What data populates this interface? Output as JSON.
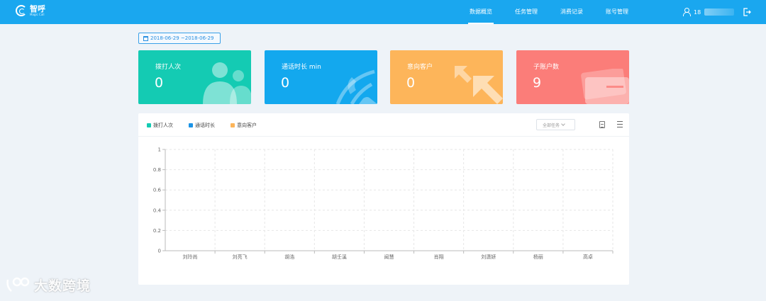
{
  "header": {
    "app_name": "智呼",
    "app_subtitle": "Magic Call",
    "nav": [
      {
        "label": "数据概览",
        "active": true
      },
      {
        "label": "任务管理",
        "active": false
      },
      {
        "label": "消费记录",
        "active": false
      },
      {
        "label": "账号管理",
        "active": false
      }
    ],
    "user_prefix": "18",
    "icons": {
      "user": "user-icon",
      "logout": "logout-icon"
    }
  },
  "date_range": "2018-06-29 ~2018-06-29",
  "stats": [
    {
      "label": "拨打人次",
      "value": "0",
      "color": "#14cbb3",
      "icon": "users-icon"
    },
    {
      "label": "通话时长 min",
      "value": "0",
      "color": "#13a8ee",
      "icon": "phone-icon"
    },
    {
      "label": "意向客户",
      "value": "0",
      "color": "#fdb55a",
      "icon": "arrow-icon"
    },
    {
      "label": "子账户数",
      "value": "9",
      "color": "#fb7d79",
      "icon": "card-icon"
    }
  ],
  "chart_panel": {
    "legend": [
      {
        "label": "拨打人次",
        "color": "#14cbb3"
      },
      {
        "label": "通话时长",
        "color": "#1c94e6"
      },
      {
        "label": "意向客户",
        "color": "#fdb55a"
      }
    ],
    "task_filter": "全部任务"
  },
  "chart_data": {
    "type": "bar",
    "categories": [
      "刘玲尚",
      "刘亮飞",
      "胡浩",
      "胡壬溪",
      "闻慧",
      "肖翔",
      "刘潇妍",
      "杨丽",
      "高卓"
    ],
    "series": [
      {
        "name": "拨打人次",
        "values": [
          0,
          0,
          0,
          0,
          0,
          0,
          0,
          0,
          0
        ]
      },
      {
        "name": "通话时长",
        "values": [
          0,
          0,
          0,
          0,
          0,
          0,
          0,
          0,
          0
        ]
      },
      {
        "name": "意向客户",
        "values": [
          0,
          0,
          0,
          0,
          0,
          0,
          0,
          0,
          0
        ]
      }
    ],
    "yticks": [
      "0",
      "0.2",
      "0.4",
      "0.6",
      "0.8",
      "1"
    ],
    "ylim": [
      0,
      1
    ],
    "grid": true,
    "legend_position": "top-left"
  },
  "watermark": "大数跨境"
}
